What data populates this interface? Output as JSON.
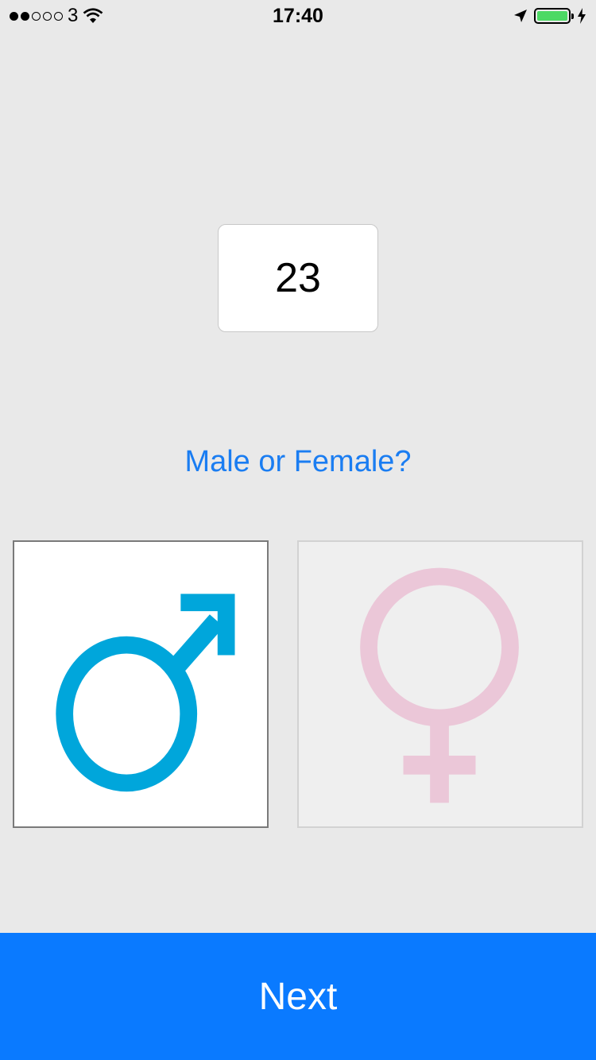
{
  "status_bar": {
    "carrier": "3",
    "time": "17:40"
  },
  "age": {
    "value": "23"
  },
  "prompt": {
    "text": "Male or Female?"
  },
  "options": {
    "male": {
      "icon": "male-symbol-icon",
      "color": "#00a6db",
      "selected": true
    },
    "female": {
      "icon": "female-symbol-icon",
      "color": "#ebc7d8",
      "selected": false
    }
  },
  "actions": {
    "next_label": "Next"
  },
  "colors": {
    "accent": "#0a7aff",
    "prompt_text": "#1a7df2",
    "battery": "#4cd964"
  }
}
